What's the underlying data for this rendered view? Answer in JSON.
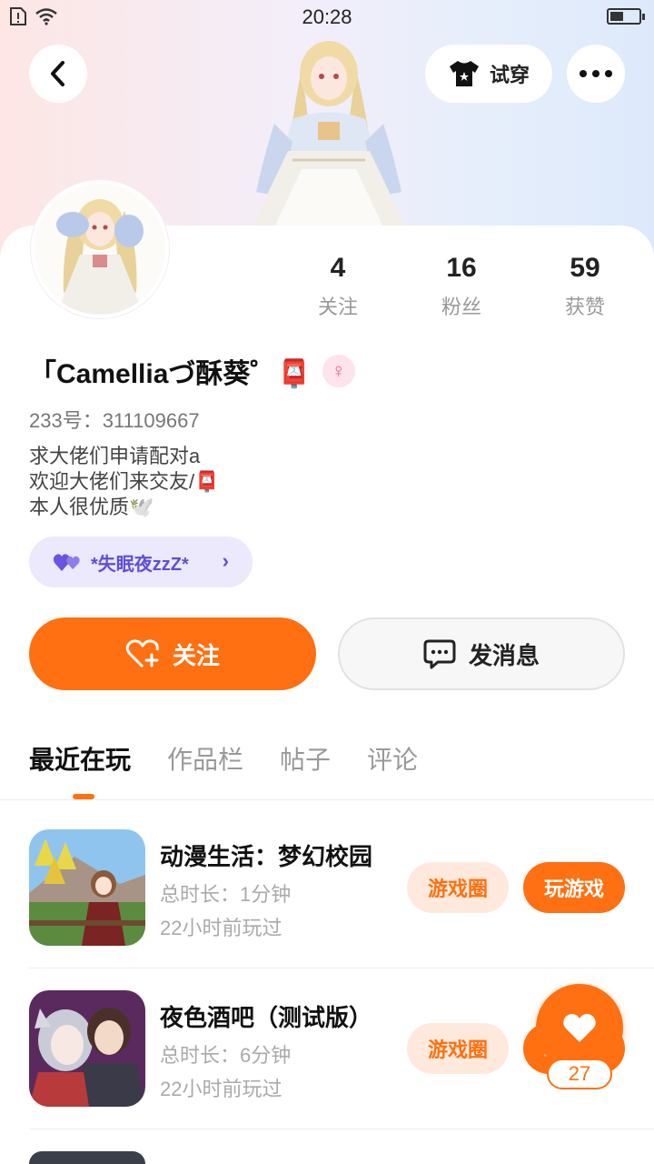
{
  "status_bar": {
    "time": "20:28"
  },
  "header": {
    "try_on_label": "试穿"
  },
  "stats": [
    {
      "value": "4",
      "label": "关注"
    },
    {
      "value": "16",
      "label": "粉丝"
    },
    {
      "value": "59",
      "label": "获赞"
    }
  ],
  "profile": {
    "name": "「Camelliaづ酥葵゜📮",
    "uid": "233号：311109667",
    "bio": [
      "求大佬们申请配对a",
      "欢迎大佬们来交友/📮",
      "本人很优质🕊️"
    ],
    "gender_icon": "female-icon",
    "group_tag": "*失眠夜zzZ*"
  },
  "actions": {
    "follow_label": "关注",
    "message_label": "发消息"
  },
  "tabs": [
    "最近在玩",
    "作品栏",
    "帖子",
    "评论"
  ],
  "games": [
    {
      "title": "动漫生活：梦幻校园",
      "duration": "总时长：1分钟",
      "last_played": "22小时前玩过",
      "circle_label": "游戏圈",
      "play_label": "玩游戏"
    },
    {
      "title": "夜色酒吧（测试版）",
      "duration": "总时长：6分钟",
      "last_played": "22小时前玩过",
      "circle_label": "游戏圈",
      "play_label": "玩游戏"
    }
  ],
  "floating_like": {
    "count": "27"
  },
  "colors": {
    "accent": "#fe7011",
    "purple": "#5e4ed8"
  }
}
